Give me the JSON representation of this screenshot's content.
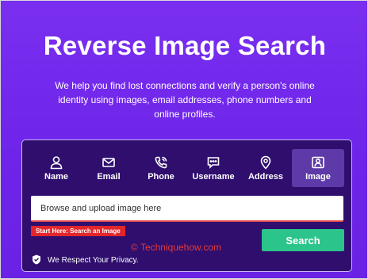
{
  "hero": {
    "title": "Reverse Image Search",
    "subtitle": "We help you find lost connections and verify a person's online identity using images, email addresses, phone numbers and online profiles."
  },
  "tabs": [
    {
      "label": "Name",
      "icon": "person-icon"
    },
    {
      "label": "Email",
      "icon": "envelope-icon"
    },
    {
      "label": "Phone",
      "icon": "phone-icon"
    },
    {
      "label": "Username",
      "icon": "chat-icon"
    },
    {
      "label": "Address",
      "icon": "location-pin-icon"
    },
    {
      "label": "Image",
      "icon": "image-icon",
      "active": true
    }
  ],
  "search": {
    "placeholder": "Browse and upload image here",
    "start_label": "Start Here: Search an Image",
    "button_label": "Search"
  },
  "privacy": {
    "text": "We Respect Your Privacy."
  },
  "watermark": {
    "text": "© Techniquehow.com"
  },
  "colors": {
    "background": "#7a2ff0",
    "panel": "#2f0e6e",
    "active_tab": "#5d3aa8",
    "search_button": "#2bc48a",
    "start_tag": "#e2262b",
    "watermark": "#e53935"
  }
}
